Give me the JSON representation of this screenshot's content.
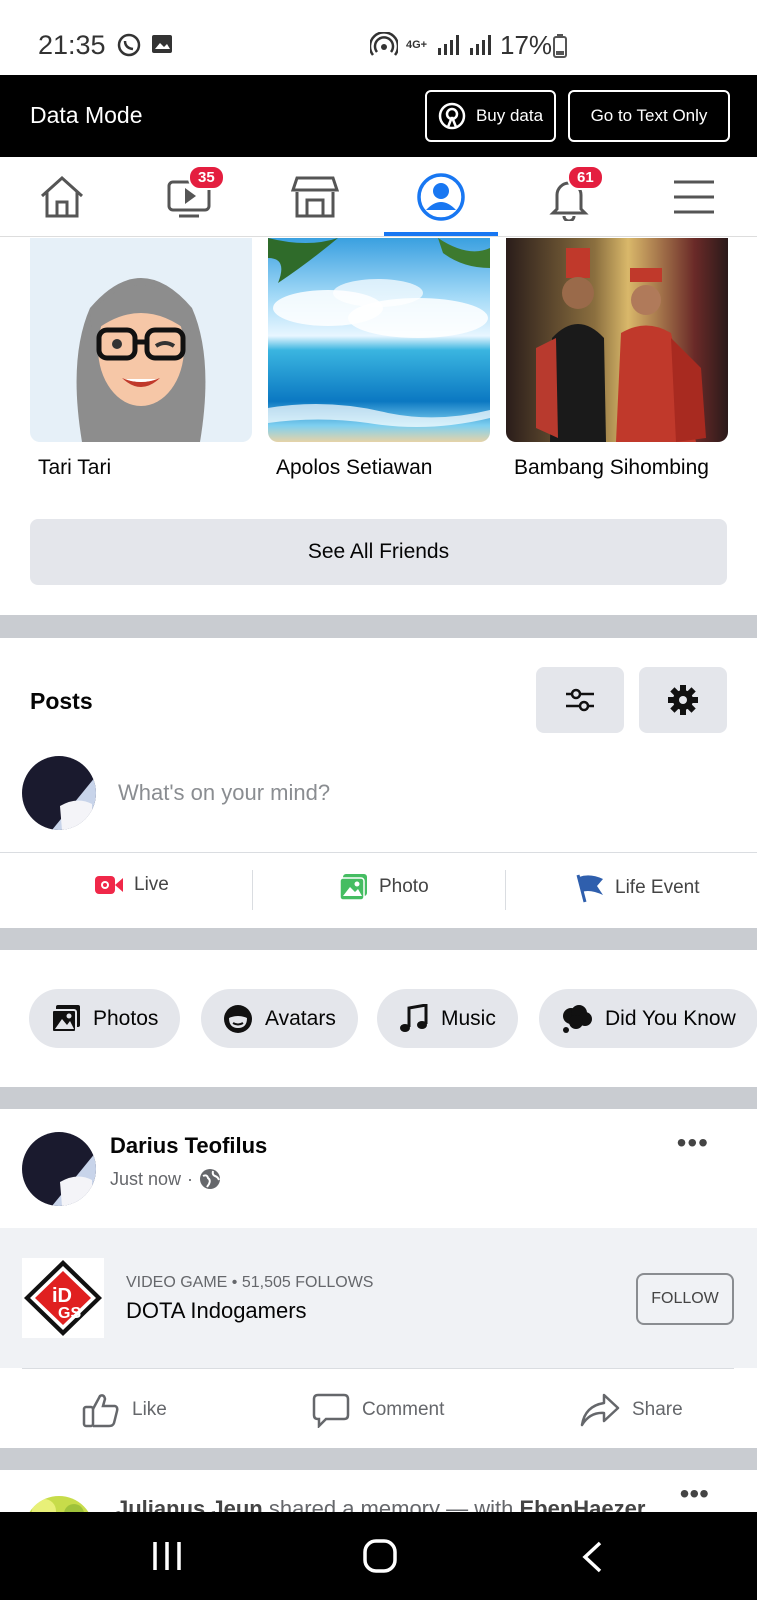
{
  "status": {
    "time": "21:35",
    "battery": "17%",
    "network": "4G+"
  },
  "data_mode": {
    "title": "Data Mode",
    "buy_label": "Buy data",
    "text_only_label": "Go to Text Only"
  },
  "nav": {
    "watch_badge": "35",
    "notif_badge": "61"
  },
  "friends": [
    {
      "name": "Tari Tari"
    },
    {
      "name": "Apolos Setiawan"
    },
    {
      "name": "Bambang Sihombing"
    }
  ],
  "see_all_label": "See All Friends",
  "posts": {
    "title": "Posts",
    "placeholder": "What's on your mind?",
    "actions": [
      "Live",
      "Photo",
      "Life Event"
    ]
  },
  "chips": [
    "Photos",
    "Avatars",
    "Music",
    "Did You Know"
  ],
  "post": {
    "author": "Darius Teofilus",
    "time": "Just now",
    "page_meta": "VIDEO GAME • 51,505 FOLLOWS",
    "page_name": "DOTA Indogamers",
    "follow_label": "FOLLOW",
    "like_label": "Like",
    "comment_label": "Comment",
    "share_label": "Share"
  },
  "next_post": {
    "author": "Julianus Jeun",
    "middle": " shared a memory — with ",
    "with": "EbenHaezer"
  }
}
